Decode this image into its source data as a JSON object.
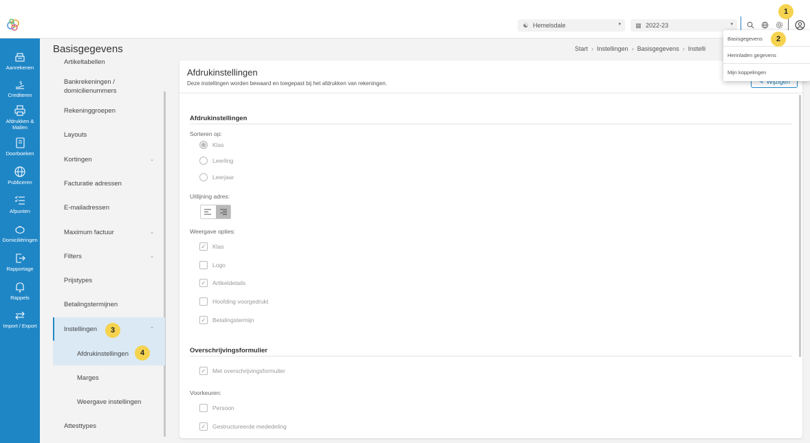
{
  "topbar": {
    "school": "Hemelsdale",
    "year": "2022-23"
  },
  "sidebar": {
    "items": [
      {
        "label": "Aanrekenen",
        "icon": "cash-register-icon"
      },
      {
        "label": "Crediteren",
        "icon": "credit-hand-icon"
      },
      {
        "label": "Afdrukken & Mailen",
        "icon": "printer-icon"
      },
      {
        "label": "Doorboeken",
        "icon": "book-icon"
      },
      {
        "label": "Publiceren",
        "icon": "globe-icon"
      },
      {
        "label": "Afpunten",
        "icon": "checklist-icon"
      },
      {
        "label": "Domiciliëringen",
        "icon": "piggy-bank-icon"
      },
      {
        "label": "Rapportage",
        "icon": "report-export-icon"
      },
      {
        "label": "Rappels",
        "icon": "bell-icon"
      },
      {
        "label": "Import / Export",
        "icon": "transfer-icon"
      }
    ]
  },
  "submenu": {
    "title": "Basisgegevens",
    "items": [
      {
        "label": "Artikeltabellen"
      },
      {
        "label": "Bankrekeningen / domicilienummers"
      },
      {
        "label": "Rekeninggroepen"
      },
      {
        "label": "Layouts"
      },
      {
        "label": "Kortingen"
      },
      {
        "label": "Facturatie adressen"
      },
      {
        "label": "E-mailadressen"
      },
      {
        "label": "Maximum factuur"
      },
      {
        "label": "Filters"
      },
      {
        "label": "Prijstypes"
      },
      {
        "label": "Betalingstermijnen"
      },
      {
        "label": "Instellingen"
      },
      {
        "label": "Afdrukinstellingen"
      },
      {
        "label": "Marges"
      },
      {
        "label": "Weergave instellingen"
      },
      {
        "label": "Attesttypes"
      }
    ]
  },
  "breadcrumb": [
    "Start",
    "Instellingen",
    "Basisgegevens",
    "Instelli"
  ],
  "main": {
    "title": "Afdrukinstellingen",
    "subtitle": "Deze instellingen worden bewaard en toegepast bij het afdrukken van rekeningen.",
    "edit_label": "Wijzigen",
    "section1_title": "Afdrukinstellingen",
    "sort_label": "Sorteren op:",
    "sort_options": [
      "Klas",
      "Leerling",
      "Leerjaar"
    ],
    "align_label": "Uitlijning adres:",
    "display_label": "Weergave opties:",
    "display_options": [
      "Klas",
      "Logo",
      "Artikeldetails",
      "Hoofding voorgedrukt",
      "Betalingstermijn"
    ],
    "section2_title": "Overschrijvingsformulier",
    "transfer_option": "Met overschrijvingsformulier",
    "pref_label": "Voorkeuren:",
    "pref_options": [
      "Persoon",
      "Gestructureerde mededeling"
    ]
  },
  "popup": {
    "items": [
      "Basisgegevens",
      "Herinladen gegevens",
      "Mijn koppelingen"
    ]
  },
  "badges": [
    "1",
    "2",
    "3",
    "4"
  ],
  "colors": {
    "sidebar": "#1f86c6",
    "accent": "#1f86c6",
    "badge": "#f6d34f",
    "active_bg": "#dbe9f4"
  }
}
